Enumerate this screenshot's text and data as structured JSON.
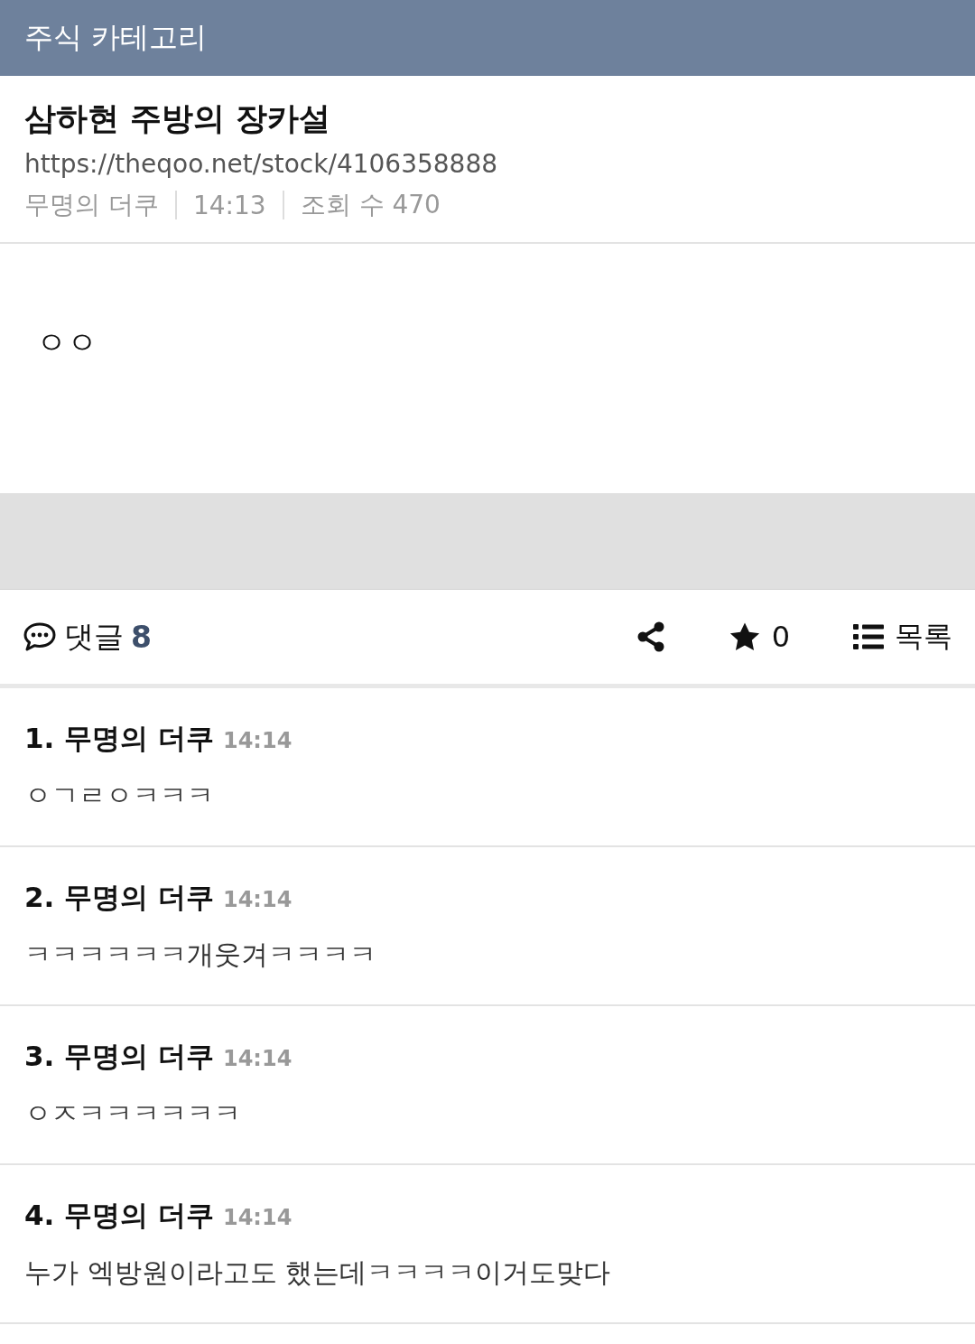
{
  "header": {
    "title": "주식 카테고리"
  },
  "post": {
    "title": "삼하현 주방의 장카설",
    "url": "https://theqoo.net/stock/4106358888",
    "meta": [
      "무명의 더쿠",
      "14:13",
      "조회 수 470"
    ],
    "body": "ㅇㅇ"
  },
  "toolbar": {
    "comments_label": "댓글",
    "comments_count": "8",
    "star_count": "0",
    "list_label": "목록"
  },
  "comments": [
    {
      "number": "1.",
      "author": "무명의 더쿠",
      "time": "14:14",
      "text": "ㅇㄱㄹㅇㅋㅋㅋ"
    },
    {
      "number": "2.",
      "author": "무명의 더쿠",
      "time": "14:14",
      "text": "ㅋㅋㅋㅋㅋㅋ개웃겨ㅋㅋㅋㅋ"
    },
    {
      "number": "3.",
      "author": "무명의 더쿠",
      "time": "14:14",
      "text": "ㅇㅈㅋㅋㅋㅋㅋㅋ"
    },
    {
      "number": "4.",
      "author": "무명의 더쿠",
      "time": "14:14",
      "text": "누가 엑방원이라고도 했는데ㅋㅋㅋㅋ이거도맞다"
    }
  ]
}
